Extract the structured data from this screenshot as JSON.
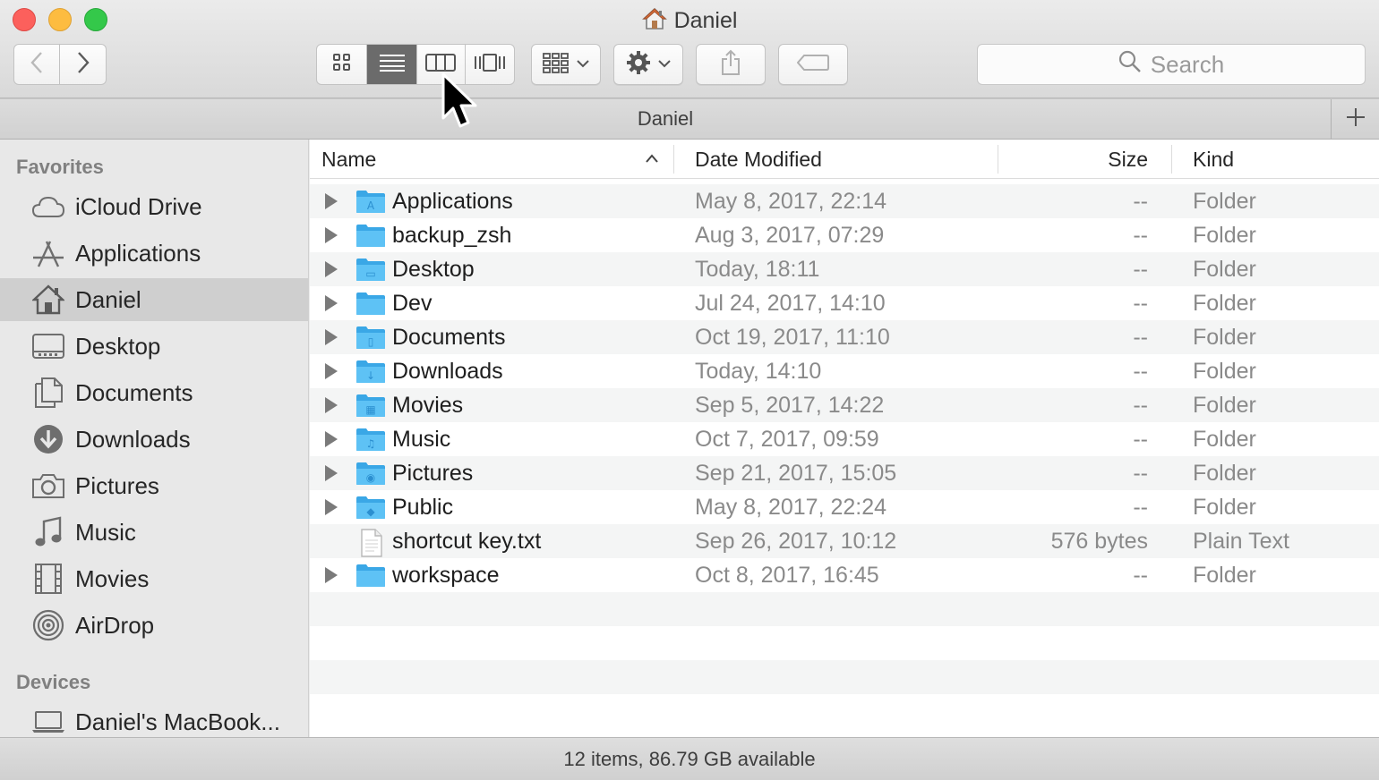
{
  "window": {
    "title": "Daniel",
    "title_icon": "home-icon"
  },
  "toolbar": {
    "back_icon": "chevron-left-icon",
    "forward_icon": "chevron-right-icon",
    "view_modes": [
      "icon-view",
      "list-view",
      "column-view",
      "cover-flow-view"
    ],
    "active_view": "list-view",
    "arrange_icon": "group-grid-icon",
    "action_icon": "gear-icon",
    "share_icon": "share-icon",
    "tags_icon": "tag-icon",
    "search_placeholder": "Search"
  },
  "pathbar": {
    "label": "Daniel",
    "add_tab_icon": "plus-icon"
  },
  "sidebar": {
    "favorites_heading": "Favorites",
    "favorites": [
      {
        "label": "iCloud Drive",
        "icon": "cloud-icon"
      },
      {
        "label": "Applications",
        "icon": "applications-icon"
      },
      {
        "label": "Daniel",
        "icon": "home-icon",
        "selected": true
      },
      {
        "label": "Desktop",
        "icon": "desktop-icon"
      },
      {
        "label": "Documents",
        "icon": "document-icon"
      },
      {
        "label": "Downloads",
        "icon": "download-icon"
      },
      {
        "label": "Pictures",
        "icon": "camera-icon"
      },
      {
        "label": "Music",
        "icon": "music-note-icon"
      },
      {
        "label": "Movies",
        "icon": "film-icon"
      },
      {
        "label": "AirDrop",
        "icon": "airdrop-icon"
      }
    ],
    "devices_heading": "Devices",
    "devices": [
      {
        "label": "Daniel's MacBook...",
        "icon": "laptop-icon"
      }
    ]
  },
  "columns": {
    "name": "Name",
    "date": "Date Modified",
    "size": "Size",
    "kind": "Kind",
    "sort_icon": "sort-ascending-icon"
  },
  "files": [
    {
      "name": "Applications",
      "date": "May 8, 2017, 22:14",
      "size": "--",
      "kind": "Folder",
      "folder": true,
      "badge": "A"
    },
    {
      "name": "backup_zsh",
      "date": "Aug 3, 2017, 07:29",
      "size": "--",
      "kind": "Folder",
      "folder": true,
      "badge": ""
    },
    {
      "name": "Desktop",
      "date": "Today, 18:11",
      "size": "--",
      "kind": "Folder",
      "folder": true,
      "badge": "▭"
    },
    {
      "name": "Dev",
      "date": "Jul 24, 2017, 14:10",
      "size": "--",
      "kind": "Folder",
      "folder": true,
      "badge": ""
    },
    {
      "name": "Documents",
      "date": "Oct 19, 2017, 11:10",
      "size": "--",
      "kind": "Folder",
      "folder": true,
      "badge": "▯"
    },
    {
      "name": "Downloads",
      "date": "Today, 14:10",
      "size": "--",
      "kind": "Folder",
      "folder": true,
      "badge": "↓"
    },
    {
      "name": "Movies",
      "date": "Sep 5, 2017, 14:22",
      "size": "--",
      "kind": "Folder",
      "folder": true,
      "badge": "▦"
    },
    {
      "name": "Music",
      "date": "Oct 7, 2017, 09:59",
      "size": "--",
      "kind": "Folder",
      "folder": true,
      "badge": "♫"
    },
    {
      "name": "Pictures",
      "date": "Sep 21, 2017, 15:05",
      "size": "--",
      "kind": "Folder",
      "folder": true,
      "badge": "◉"
    },
    {
      "name": "Public",
      "date": "May 8, 2017, 22:24",
      "size": "--",
      "kind": "Folder",
      "folder": true,
      "badge": "◆"
    },
    {
      "name": "shortcut key.txt",
      "date": "Sep 26, 2017, 10:12",
      "size": "576 bytes",
      "kind": "Plain Text",
      "folder": false,
      "badge": ""
    },
    {
      "name": "workspace",
      "date": "Oct 8, 2017, 16:45",
      "size": "--",
      "kind": "Folder",
      "folder": true,
      "badge": ""
    }
  ],
  "status": {
    "text": "12 items, 86.79 GB available"
  },
  "colors": {
    "folder_blue": "#5ec2f5",
    "folder_blue_dark": "#3aa7e6",
    "selection_gray": "#cfcfcf"
  }
}
